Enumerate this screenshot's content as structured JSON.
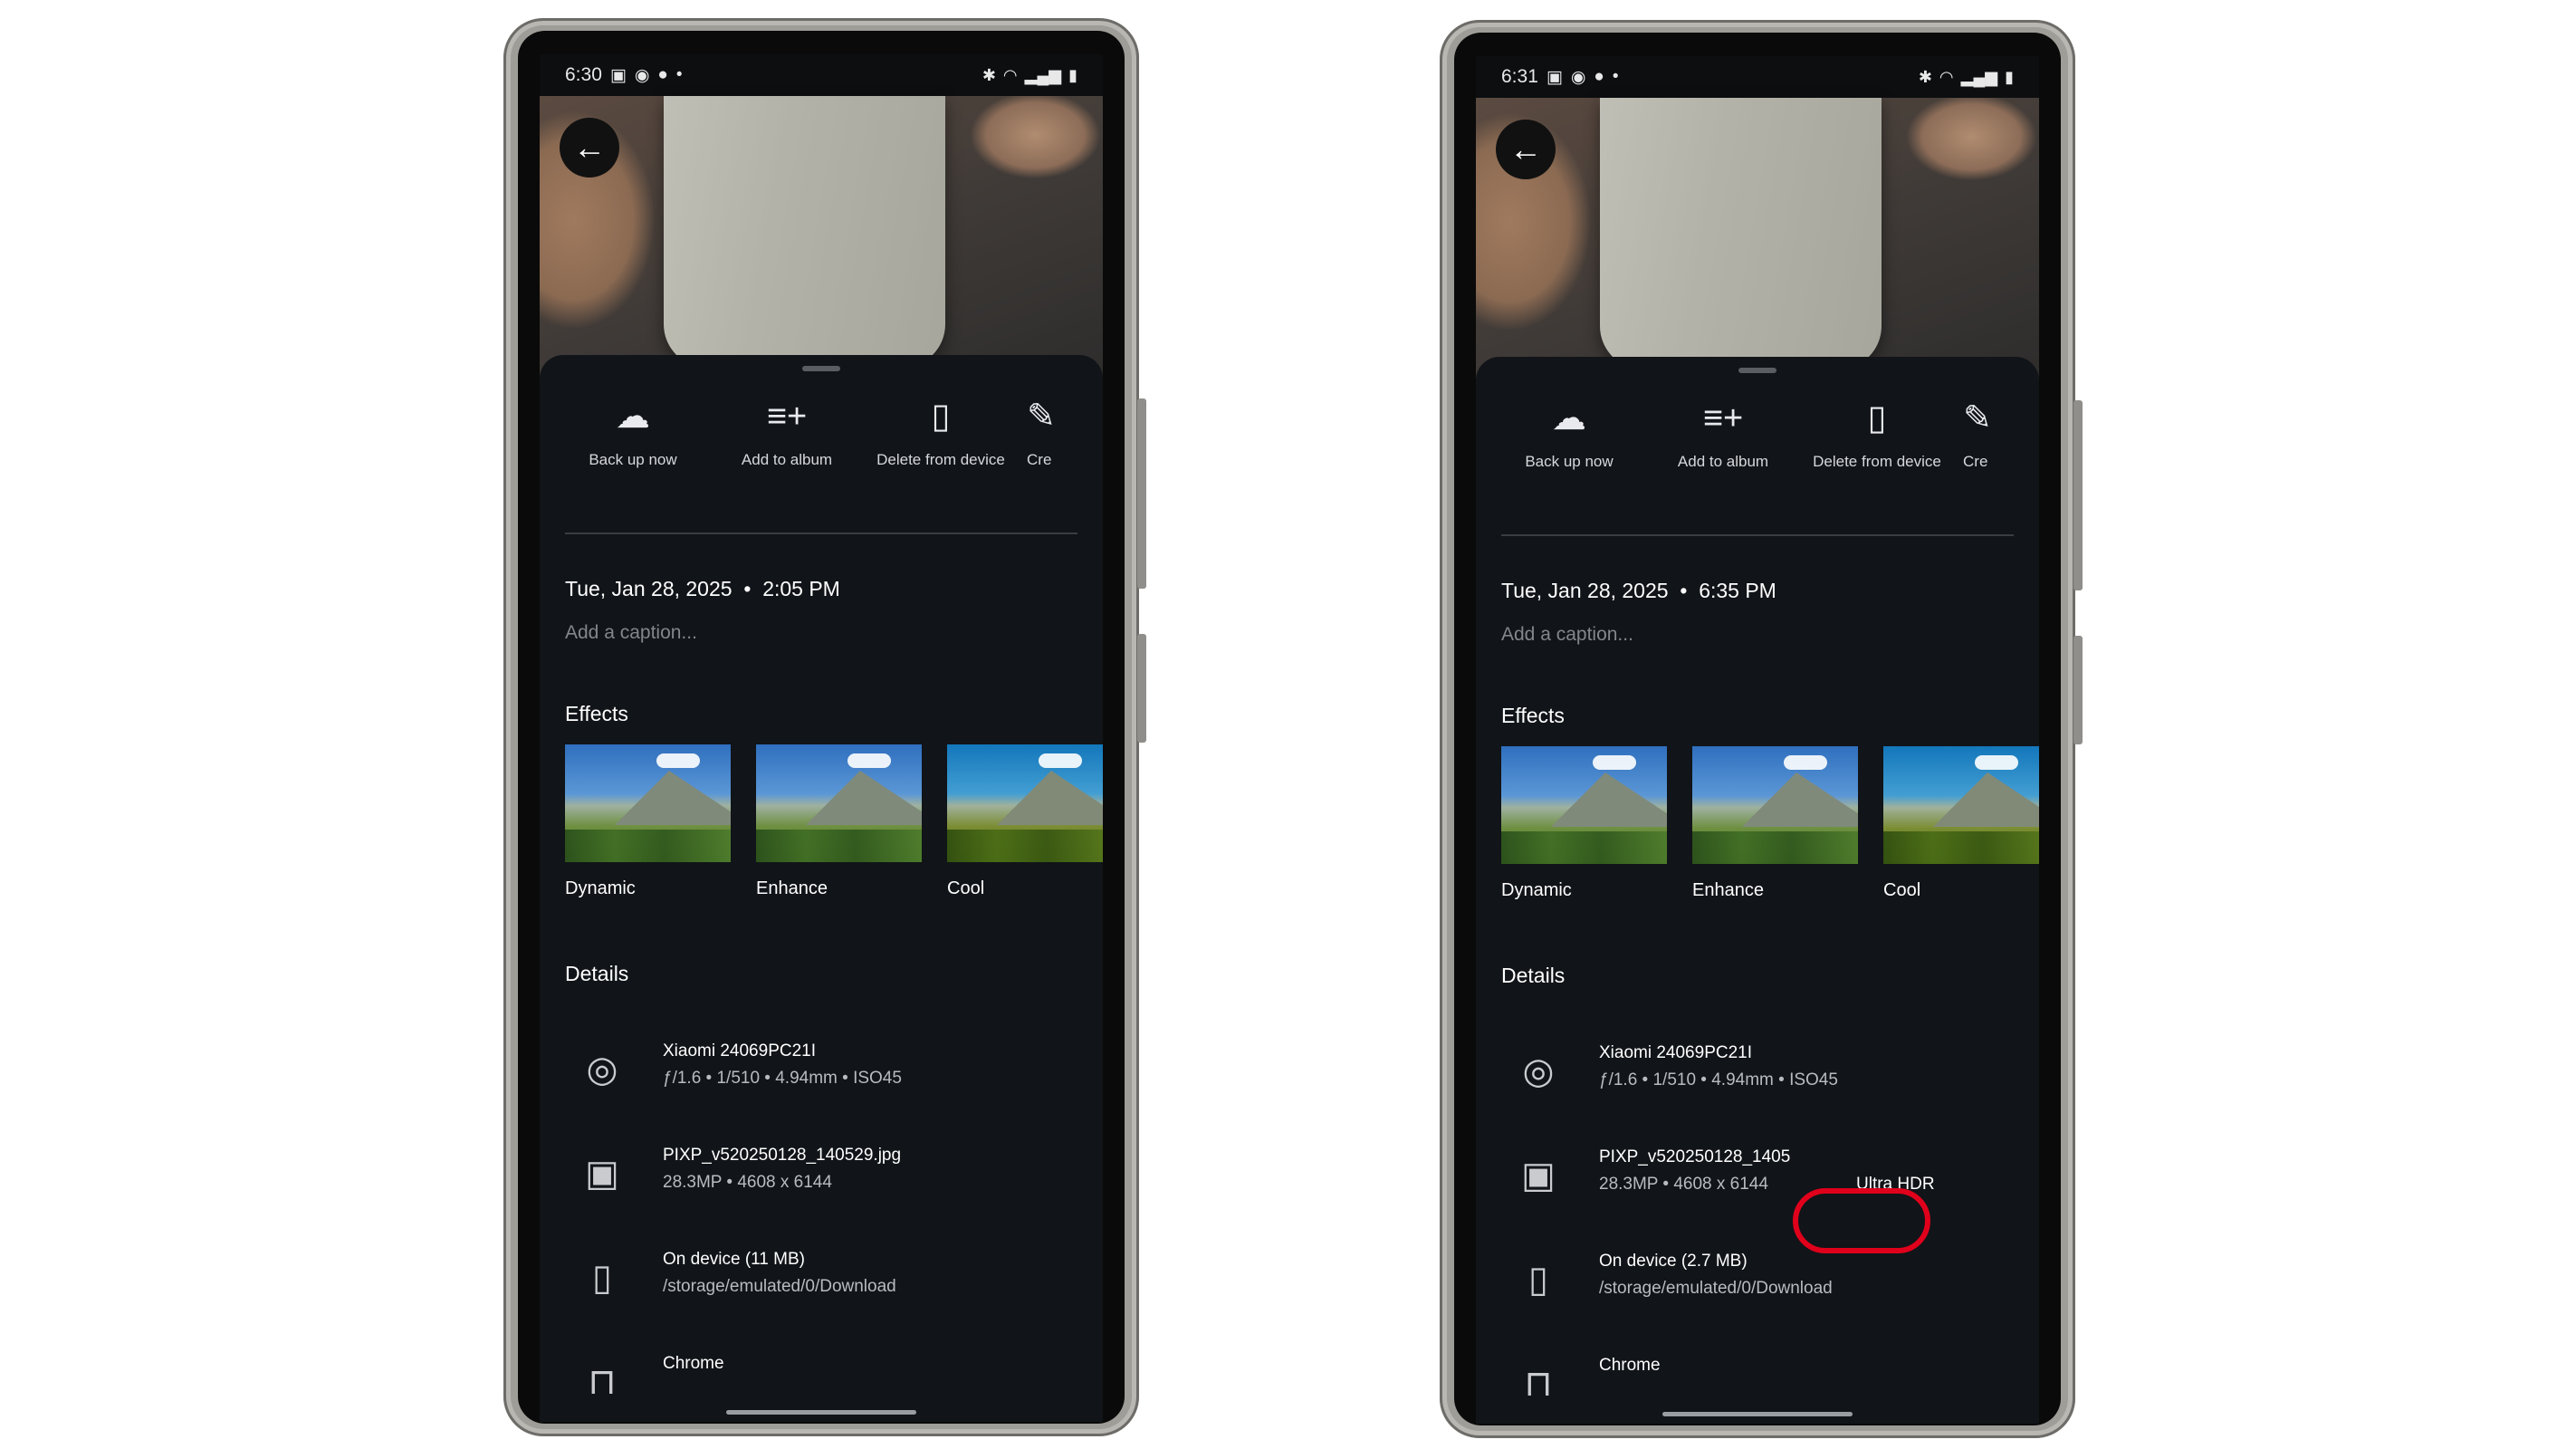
{
  "phones": [
    {
      "status_time": "6:30",
      "date": "Tue, Jan 28, 2025",
      "time": "2:05 PM",
      "caption_placeholder": "Add a caption...",
      "actions": [
        "Back up now",
        "Add to album",
        "Delete from device",
        "Cre"
      ],
      "effects_heading": "Effects",
      "effects": [
        "Dynamic",
        "Enhance",
        "Cool"
      ],
      "details_heading": "Details",
      "camera": {
        "model": "Xiaomi 24069PC21I",
        "specs": "ƒ/1.6  •  1/510  •  4.94mm  •  ISO45"
      },
      "file": {
        "name": "PIXP_v520250128_140529.jpg",
        "specs": "28.3MP  •  4608 x 6144",
        "badge": ""
      },
      "storage": {
        "size": "On device (11 MB)",
        "path": "/storage/emulated/0/Download"
      },
      "folder": "Chrome"
    },
    {
      "status_time": "6:31",
      "date": "Tue, Jan 28, 2025",
      "time": "6:35 PM",
      "caption_placeholder": "Add a caption...",
      "actions": [
        "Back up now",
        "Add to album",
        "Delete from device",
        "Cre"
      ],
      "effects_heading": "Effects",
      "effects": [
        "Dynamic",
        "Enhance",
        "Cool"
      ],
      "details_heading": "Details",
      "camera": {
        "model": "Xiaomi 24069PC21I",
        "specs": "ƒ/1.6  •  1/510  •  4.94mm  •  ISO45"
      },
      "file": {
        "name": "PIXP_v520250128_1405",
        "specs": "28.3MP  •  4608 x 6144",
        "badge": "Ultra HDR"
      },
      "storage": {
        "size": "On device (2.7 MB)",
        "path": "/storage/emulated/0/Download"
      },
      "folder": "Chrome"
    }
  ],
  "icons": {
    "back": "arrow-left-icon",
    "backup": "cloud-upload-icon",
    "album": "playlist-add-icon",
    "delete": "phone-delete-icon",
    "camera": "aperture-icon",
    "image": "image-icon",
    "device": "smartphone-icon",
    "folder": "folder-icon"
  },
  "highlight_color": "#e0001b"
}
